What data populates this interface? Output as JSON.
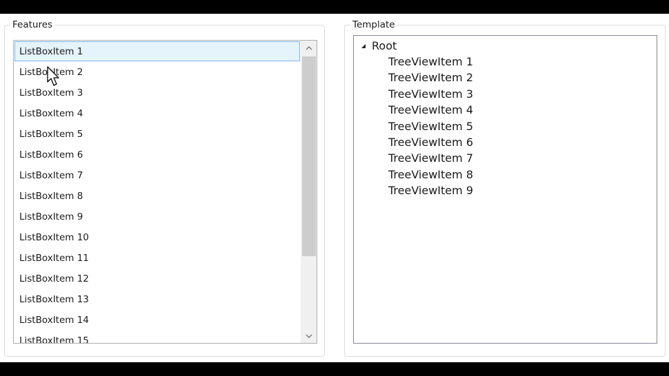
{
  "features": {
    "header": "Features",
    "items": [
      "ListBoxItem 1",
      "ListBoxItem 2",
      "ListBoxItem 3",
      "ListBoxItem 4",
      "ListBoxItem 5",
      "ListBoxItem 6",
      "ListBoxItem 7",
      "ListBoxItem 8",
      "ListBoxItem 9",
      "ListBoxItem 10",
      "ListBoxItem 11",
      "ListBoxItem 12",
      "ListBoxItem 13",
      "ListBoxItem 14",
      "ListBoxItem 15"
    ],
    "selected_index": 0
  },
  "template": {
    "header": "Template",
    "root_label": "Root",
    "children": [
      "TreeViewItem 1",
      "TreeViewItem 2",
      "TreeViewItem 3",
      "TreeViewItem 4",
      "TreeViewItem 5",
      "TreeViewItem 6",
      "TreeViewItem 7",
      "TreeViewItem 8",
      "TreeViewItem 9"
    ]
  },
  "icons": {
    "scroll_up": "chevron-up-icon",
    "scroll_down": "chevron-down-icon",
    "tree_toggle": "expanded-triangle-icon",
    "cursor": "mouse-pointer-icon"
  },
  "colors": {
    "selection_bg": "#e5f3fb",
    "selection_border": "#7eb4ea",
    "scroll_thumb": "#cdcdcd"
  }
}
